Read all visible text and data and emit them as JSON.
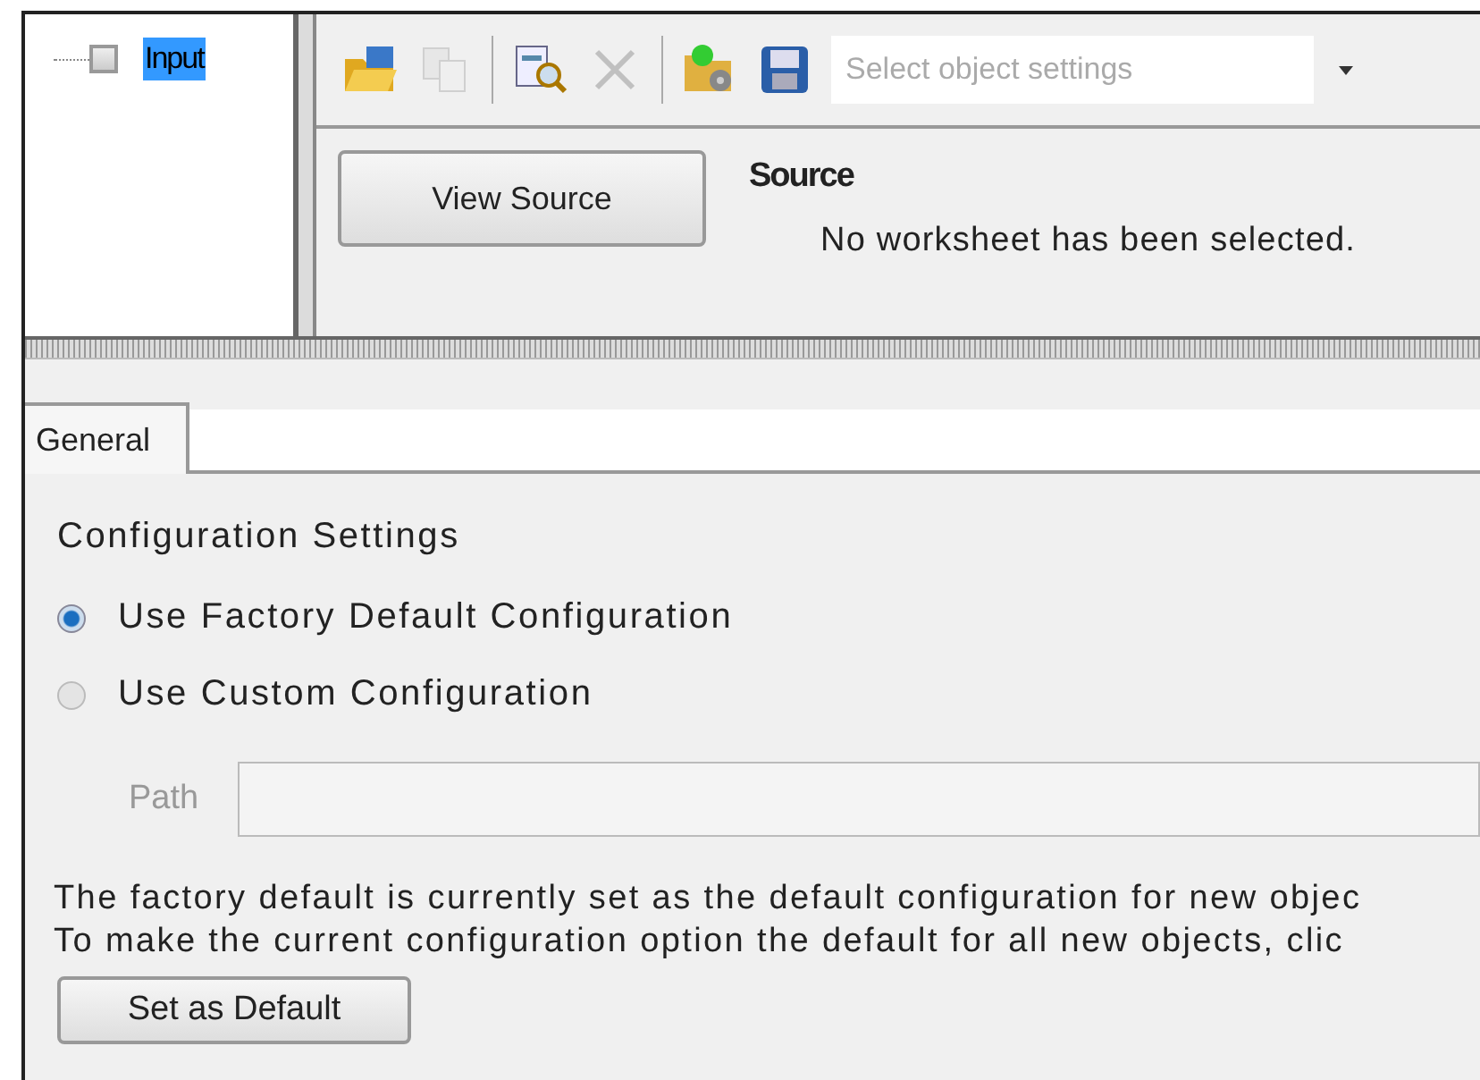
{
  "tree": [
    {
      "label": "Input",
      "checked": false,
      "selected": true
    }
  ],
  "toolbar": {
    "buttons": [
      {
        "kind": "open",
        "disabled": false
      },
      {
        "kind": "copy",
        "disabled": true
      },
      {
        "kind": "separator"
      },
      {
        "kind": "inspect",
        "disabled": false
      },
      {
        "kind": "delete",
        "disabled": true
      },
      {
        "kind": "separator"
      },
      {
        "kind": "settings",
        "disabled": false
      },
      {
        "kind": "save",
        "disabled": false
      }
    ],
    "combo": {
      "placeholder": "Select object settings"
    }
  },
  "view_source_button": "View Source",
  "source": {
    "title": "Source",
    "message": "No worksheet has been selected."
  },
  "tabs": [
    {
      "label": "General",
      "selected": true
    }
  ],
  "group": {
    "title": "Configuration Settings",
    "options": [
      {
        "label": "Use Factory Default Configuration",
        "selected": true
      },
      {
        "label": "Use Custom Configuration",
        "selected": false
      }
    ],
    "path": {
      "label": "Path",
      "disabled": true
    }
  },
  "notes": [
    "The factory default is currently set as the default configuration for new objec",
    "To make the current configuration option the default for all new objects, clic"
  ],
  "default_button": "Set as Default"
}
